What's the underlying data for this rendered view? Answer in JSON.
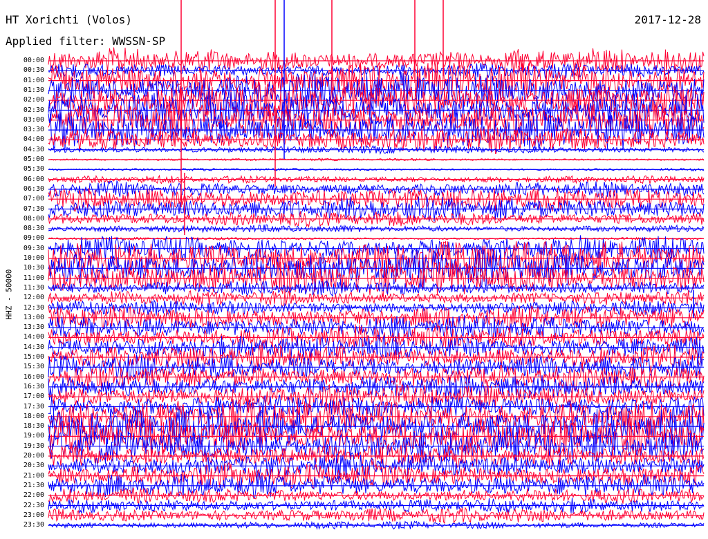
{
  "header": {
    "title": "HT Xorichti (Volos)",
    "filter": "Applied filter: WWSSN-SP",
    "date": "2017-12-28"
  },
  "chart_data": {
    "type": "line",
    "title": "HT Xorichti (Volos)",
    "subtitle": "Applied filter: WWSSN-SP",
    "date": "2017-12-28",
    "ylabel": "HHZ - 50000",
    "xlabel": "",
    "trace_colors": [
      "#ff0033",
      "#0000ff"
    ],
    "row_labels": [
      "00:00",
      "00:30",
      "01:00",
      "01:30",
      "02:00",
      "02:30",
      "03:00",
      "03:30",
      "04:00",
      "04:30",
      "05:00",
      "05:30",
      "06:00",
      "06:30",
      "07:00",
      "07:30",
      "08:00",
      "08:30",
      "09:00",
      "09:30",
      "10:00",
      "10:30",
      "11:00",
      "11:30",
      "12:00",
      "12:30",
      "13:00",
      "13:30",
      "14:00",
      "14:30",
      "15:00",
      "15:30",
      "16:00",
      "16:30",
      "17:00",
      "17:30",
      "18:00",
      "18:30",
      "19:00",
      "19:30",
      "20:00",
      "20:30",
      "21:00",
      "21:30",
      "22:00",
      "22:30",
      "23:00",
      "23:30"
    ],
    "amplitude_level": [
      3,
      2,
      4,
      4,
      4,
      4,
      4,
      4,
      3,
      1,
      0,
      0,
      1,
      2,
      3,
      3,
      2,
      1,
      0,
      3,
      4,
      4,
      4,
      2,
      2,
      2,
      3,
      3,
      3,
      3,
      3,
      3,
      3,
      3,
      3,
      3,
      4,
      4,
      4,
      4,
      3,
      3,
      3,
      3,
      2,
      2,
      2,
      1
    ]
  }
}
